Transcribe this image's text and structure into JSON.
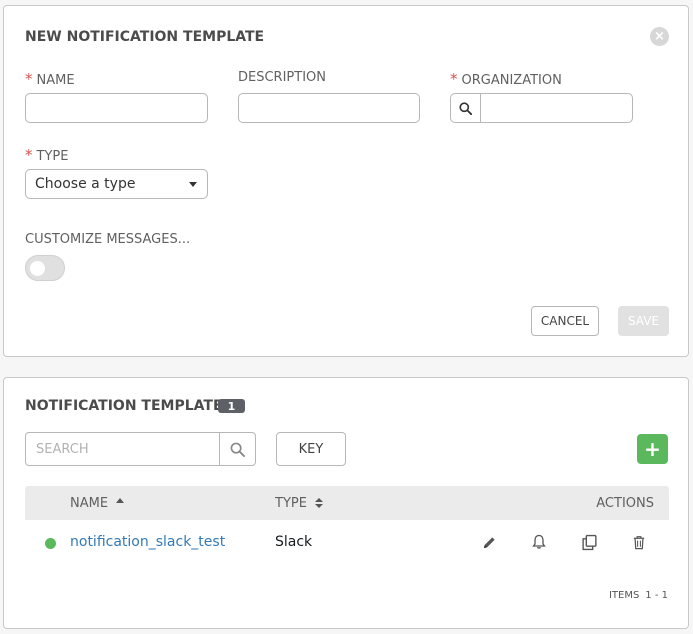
{
  "form": {
    "title": "NEW NOTIFICATION TEMPLATE",
    "close_symbol": "×",
    "required_marker": "*",
    "name_label": "NAME",
    "name_value": "",
    "description_label": "DESCRIPTION",
    "description_value": "",
    "organization_label": "ORGANIZATION",
    "organization_value": "",
    "type_label": "TYPE",
    "type_selected": "Choose a type",
    "customize_label": "CUSTOMIZE MESSAGES...",
    "customize_enabled": false,
    "cancel_label": "CANCEL",
    "save_label": "SAVE"
  },
  "list": {
    "title": "NOTIFICATION TEMPLATES",
    "count": "1",
    "search_placeholder": "SEARCH",
    "key_label": "KEY",
    "add_symbol": "+",
    "columns": {
      "name": "NAME",
      "type": "TYPE",
      "actions": "ACTIONS"
    },
    "rows": [
      {
        "name": "notification_slack_test",
        "type": "Slack",
        "status_color": "#5cb85c"
      }
    ],
    "items_label": "ITEMS",
    "items_range": "1 - 1"
  },
  "icons": {
    "close": "close-icon",
    "lookup": "search-icon",
    "search": "search-icon",
    "edit": "pencil-icon",
    "test": "bell-icon",
    "copy": "copy-icon",
    "delete": "trash-icon"
  },
  "colors": {
    "required": "#d9534f",
    "link": "#337ab7",
    "success": "#5cb85c",
    "badge": "#5d6166"
  }
}
